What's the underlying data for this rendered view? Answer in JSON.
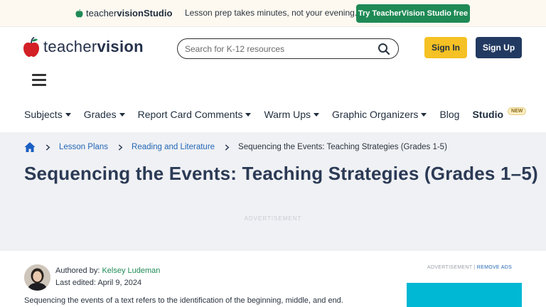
{
  "promo": {
    "logo_text_regular": "teacher",
    "logo_text_bold": "vision",
    "logo_suffix": " Studio",
    "message": "Lesson prep takes minutes, not your evening.",
    "cta_label": "Try TeacherVision Studio free"
  },
  "header": {
    "logo_regular": "teacher",
    "logo_bold": "vision",
    "search_placeholder": "Search for K-12 resources",
    "search_value": "",
    "sign_in_label": "Sign In",
    "sign_up_label": "Sign Up"
  },
  "nav": {
    "items": [
      {
        "label": "Subjects"
      },
      {
        "label": "Grades"
      },
      {
        "label": "Report Card Comments"
      },
      {
        "label": "Warm Ups"
      },
      {
        "label": "Graphic Organizers"
      },
      {
        "label": "Blog"
      },
      {
        "label": "Studio"
      }
    ],
    "new_badge": "NEW"
  },
  "breadcrumb": {
    "items": [
      {
        "label": "Lesson Plans"
      },
      {
        "label": "Reading and Literature"
      },
      {
        "label": "Sequencing the Events: Teaching Strategies (Grades 1-5)"
      }
    ]
  },
  "page": {
    "title": "Sequencing the Events: Teaching Strategies (Grades 1–5)",
    "advertisement_label": "ADVERTISEMENT"
  },
  "author": {
    "prefix": "Authored by: ",
    "name": "Kelsey Ludeman",
    "edited": "Last edited: April 9, 2024"
  },
  "article": {
    "first_line": "Sequencing the events of a text refers to the identification of the beginning, middle, and end."
  },
  "sidebar": {
    "advertisement_label": "ADVERTISEMENT",
    "separator": " | ",
    "remove_ads_label": "REMOVE ADS"
  },
  "colors": {
    "brand_green": "#1f8a55",
    "sign_in_yellow": "#f5c124",
    "sign_up_navy": "#223a61",
    "link_blue": "#2367b5",
    "band_gray": "#f0f1f4",
    "ad_cyan": "#00b8d4"
  },
  "icons": [
    "apple-logo-icon",
    "search-icon",
    "hamburger-menu-icon",
    "caret-down-icon",
    "home-icon",
    "chevron-right-icon"
  ]
}
